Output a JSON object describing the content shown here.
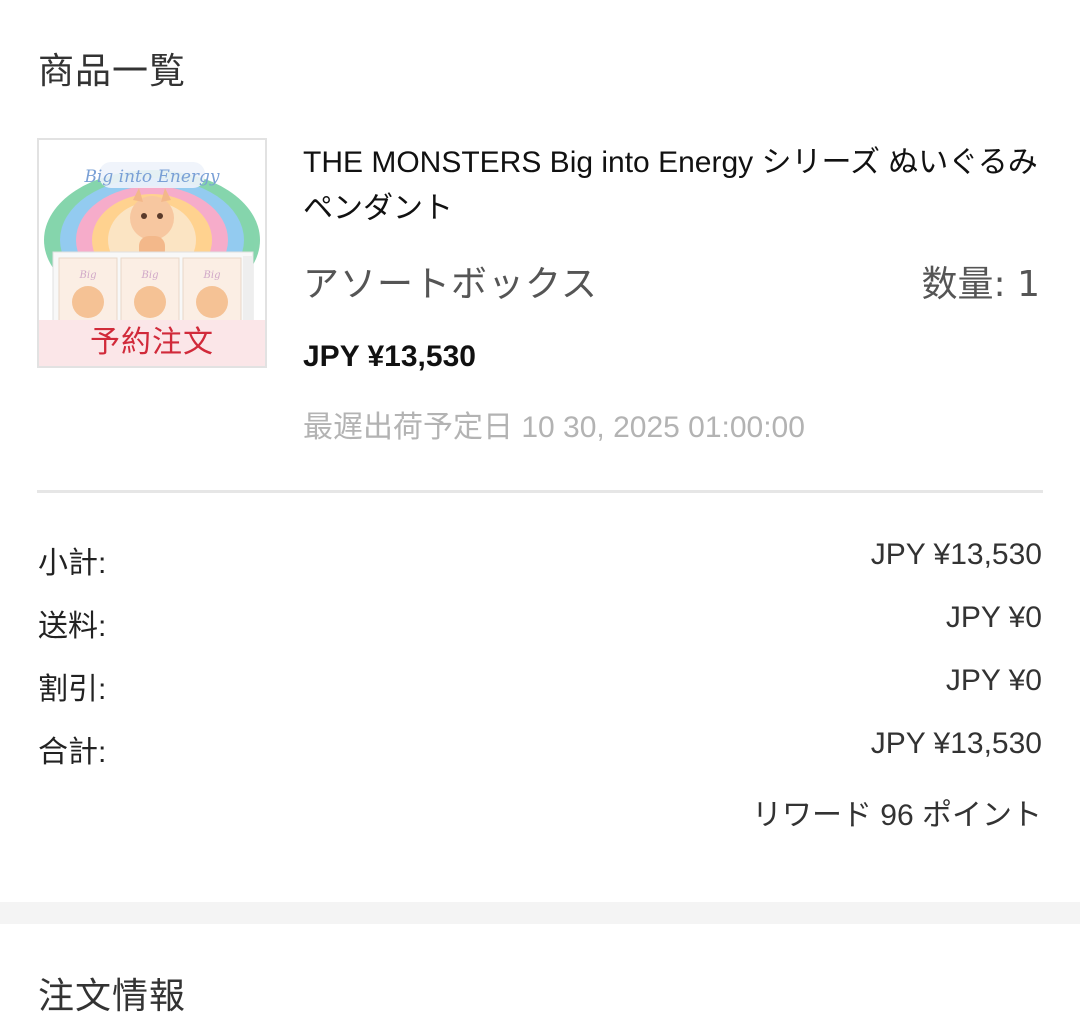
{
  "products_section": {
    "title": "商品一覧"
  },
  "product": {
    "badge": "予約注文",
    "image_text": "Big into Energy",
    "name": "THE MONSTERS Big into Energy シリーズ ぬいぐるみペンダント",
    "variant": "アソートボックス",
    "quantity": "数量: 1",
    "price": "JPY ¥13,530",
    "shipping_date": "最遅出荷予定日 10 30, 2025 01:00:00"
  },
  "summary": {
    "subtotal_label": "小計:",
    "subtotal_value": "JPY ¥13,530",
    "shipping_label": "送料:",
    "shipping_value": "JPY ¥0",
    "discount_label": "割引:",
    "discount_value": "JPY ¥0",
    "total_label": "合計:",
    "total_value": "JPY ¥13,530",
    "reward": "リワード 96 ポイント"
  },
  "order_section": {
    "title": "注文情報"
  },
  "colors": {
    "badge_text": "#d12a3a",
    "badge_bg": "#fbe6e8",
    "divider": "#e6e6e6",
    "muted_text": "#b3b3b3"
  }
}
